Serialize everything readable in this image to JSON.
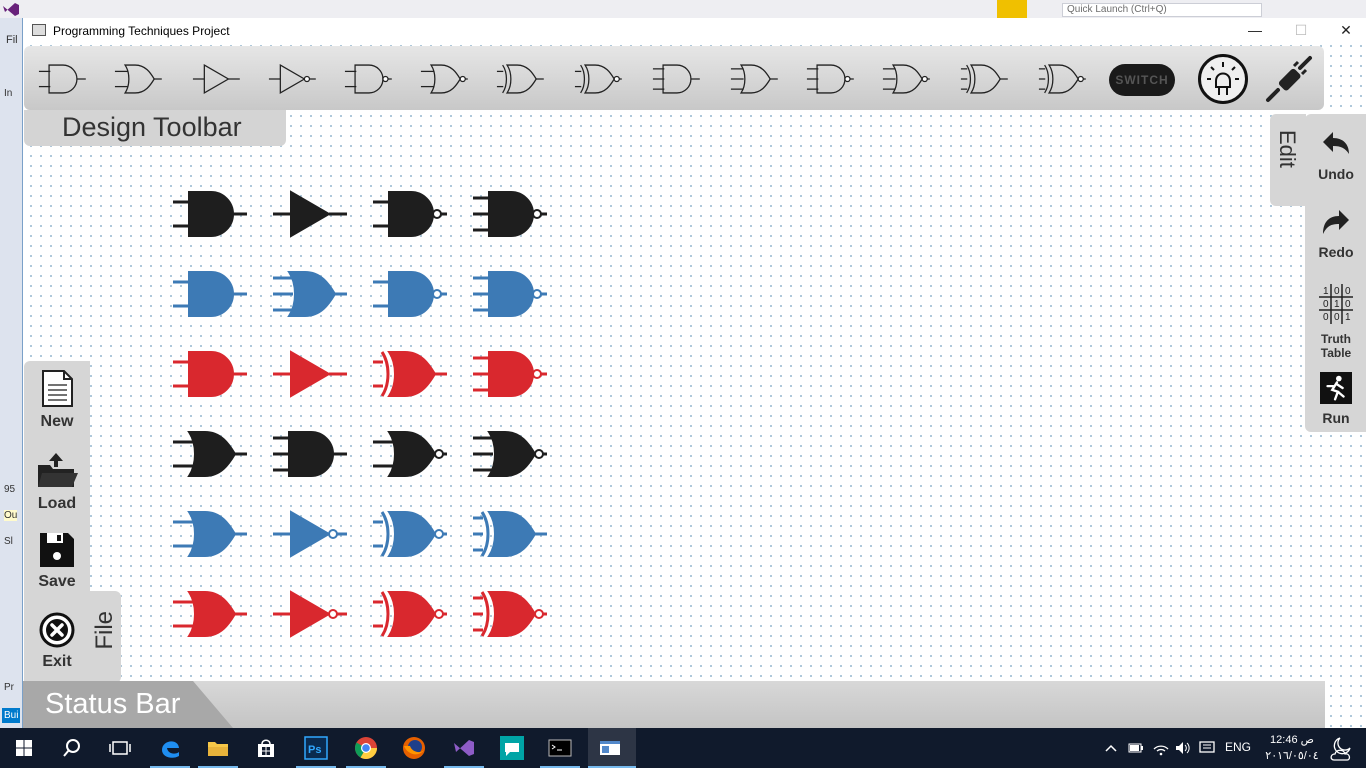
{
  "vs": {
    "quick_launch": "Quick Launch (Ctrl+Q)",
    "menu_fragment": "Fil",
    "left_fragments": [
      "In",
      "95",
      "Ou",
      "Sl",
      "Pr",
      "Bui"
    ]
  },
  "window": {
    "title": "Programming Techniques Project",
    "minimize": "—",
    "maximize": "☐",
    "close": "✕"
  },
  "toolbar": {
    "label": "Design Toolbar",
    "tools": [
      {
        "name": "and2",
        "icon": "and-gate-2-icon"
      },
      {
        "name": "or2",
        "icon": "or-gate-2-icon"
      },
      {
        "name": "buffer",
        "icon": "buffer-gate-icon"
      },
      {
        "name": "not",
        "icon": "not-gate-icon"
      },
      {
        "name": "nand2",
        "icon": "nand-gate-2-icon"
      },
      {
        "name": "nor2",
        "icon": "nor-gate-2-icon"
      },
      {
        "name": "xor2",
        "icon": "xor-gate-2-icon"
      },
      {
        "name": "xnor2",
        "icon": "xnor-gate-2-icon"
      },
      {
        "name": "and3",
        "icon": "and-gate-3-icon"
      },
      {
        "name": "or3",
        "icon": "or-gate-3-icon"
      },
      {
        "name": "nand3",
        "icon": "nand-gate-3-icon"
      },
      {
        "name": "nor3",
        "icon": "nor-gate-3-icon"
      },
      {
        "name": "xor3",
        "icon": "xor-gate-3-icon"
      },
      {
        "name": "xnor3",
        "icon": "xnor-gate-3-icon"
      }
    ],
    "switch_label": "SWITCH"
  },
  "edit": {
    "tab_label": "Edit",
    "buttons": [
      {
        "label": "Undo",
        "icon": "undo-icon"
      },
      {
        "label": "Redo",
        "icon": "redo-icon"
      },
      {
        "label": "Truth Table",
        "icon": "truth-table-icon"
      },
      {
        "label": "Run",
        "icon": "run-icon"
      }
    ]
  },
  "file": {
    "tab_label": "File",
    "buttons": [
      {
        "label": "New",
        "icon": "new-document-icon"
      },
      {
        "label": "Load",
        "icon": "load-folder-icon"
      },
      {
        "label": "Save",
        "icon": "save-floppy-icon"
      },
      {
        "label": "Exit",
        "icon": "exit-icon"
      }
    ]
  },
  "status_bar": {
    "label": "Status Bar"
  },
  "canvas": {
    "rows": [
      {
        "color": "#1e1e1e",
        "gates": [
          "and",
          "buffer",
          "nand",
          "nand3"
        ]
      },
      {
        "color": "#3d7ab5",
        "gates": [
          "and",
          "or3",
          "nand",
          "nand3"
        ]
      },
      {
        "color": "#d9282e",
        "gates": [
          "and",
          "buffer",
          "xor",
          "nand3"
        ]
      },
      {
        "color": "#1e1e1e",
        "gates": [
          "or",
          "and3",
          "nor",
          "nor3"
        ]
      },
      {
        "color": "#3d7ab5",
        "gates": [
          "or",
          "not",
          "xnor",
          "xor3"
        ]
      },
      {
        "color": "#d9282e",
        "gates": [
          "or",
          "not",
          "xnor",
          "xnor3"
        ]
      }
    ]
  },
  "taskbar": {
    "language": "ENG",
    "time": "12:46 ص",
    "date": "٢٠١٦/٠٥/٠٤"
  }
}
